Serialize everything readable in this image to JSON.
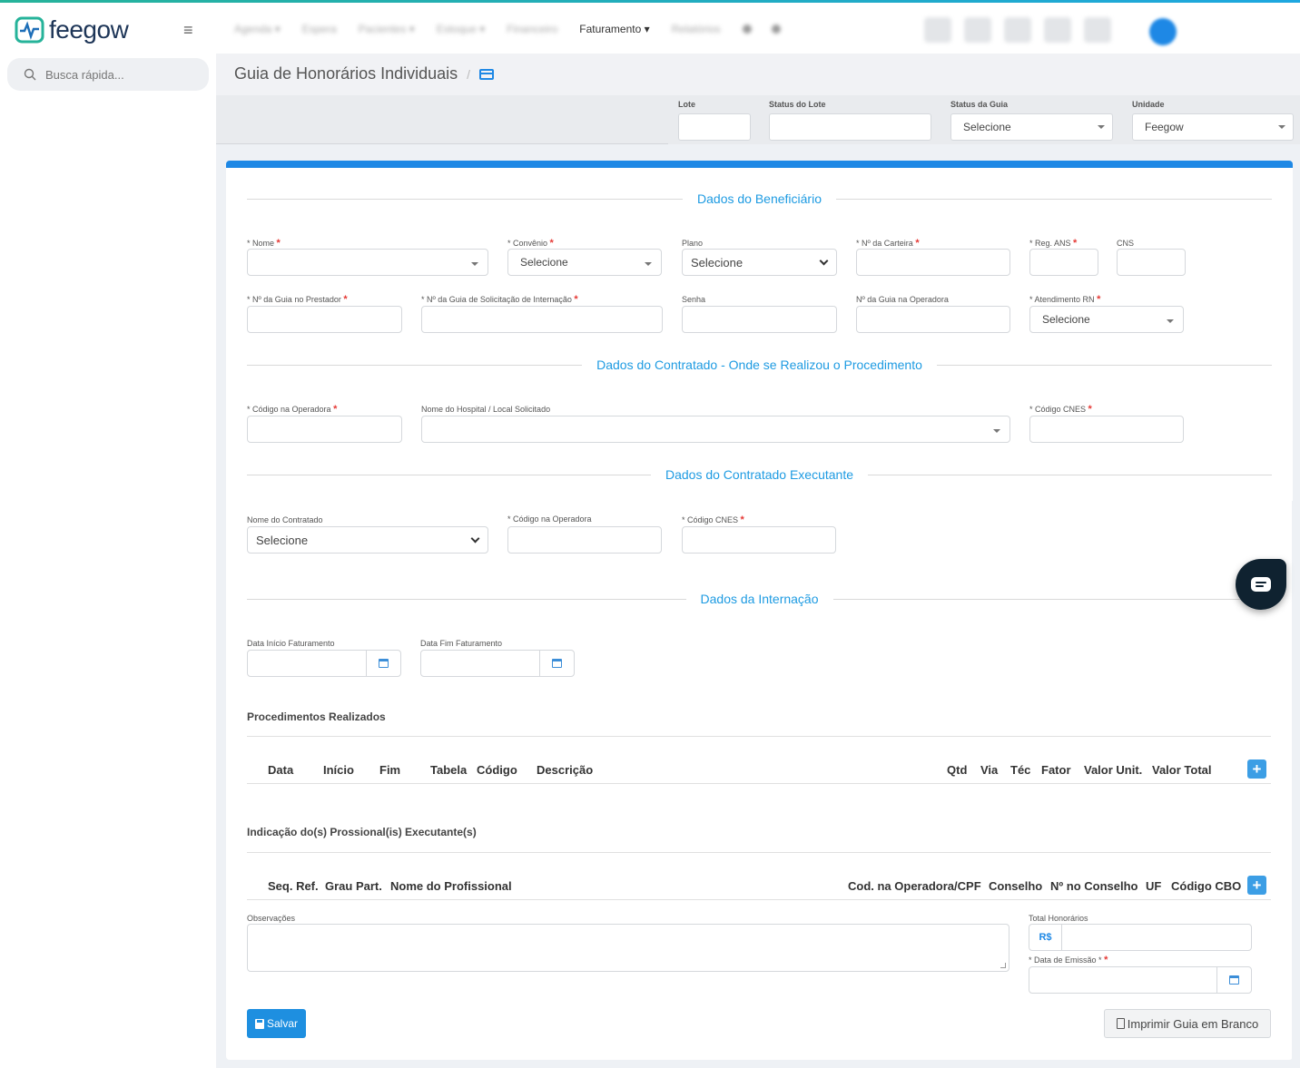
{
  "brand": {
    "name": "feegow"
  },
  "nav": {
    "items": [
      {
        "label": "Agenda ▾",
        "active": false
      },
      {
        "label": "Espera",
        "active": false
      },
      {
        "label": "Pacientes ▾",
        "active": false
      },
      {
        "label": "Estoque ▾",
        "active": false
      },
      {
        "label": "Financeiro",
        "active": false
      },
      {
        "label": "Faturamento ▾",
        "active": true
      },
      {
        "label": "Relatórios",
        "active": false
      }
    ]
  },
  "search": {
    "placeholder": "Busca rápida..."
  },
  "page": {
    "title": "Guia de Honorários Individuais",
    "separator": "/"
  },
  "filters": {
    "lote_label": "Lote",
    "status_lote_label": "Status do Lote",
    "status_guia_label": "Status da Guia",
    "status_guia_value": "Selecione",
    "unidade_label": "Unidade",
    "unidade_value": "Feegow"
  },
  "sections": {
    "beneficiario": "Dados do Beneficiário",
    "contratado": "Dados do Contratado - Onde se Realizou o Procedimento",
    "executante": "Dados do Contratado Executante",
    "internacao": "Dados da Internação"
  },
  "beneficiario": {
    "nome": "* Nome",
    "convenio": "* Convênio",
    "convenio_value": "Selecione",
    "plano": "Plano",
    "plano_value": "Selecione",
    "carteira": "* Nº da Carteira",
    "reg_ans": "* Reg. ANS",
    "cns": "CNS",
    "guia_prestador": "* Nº da Guia no Prestador",
    "guia_solicitacao": "* Nº da Guia de Solicitação de Internação",
    "senha": "Senha",
    "guia_operadora": "Nº da Guia na Operadora",
    "atendimento_rn": "* Atendimento RN",
    "atendimento_rn_value": "Selecione"
  },
  "contratado": {
    "codigo_operadora": "* Código na Operadora",
    "nome_hospital": "Nome do Hospital / Local Solicitado",
    "codigo_cnes": "* Código CNES"
  },
  "executante": {
    "nome_contratado": "Nome do Contratado",
    "nome_contratado_value": "Selecione",
    "codigo_operadora": "* Código na Operadora",
    "codigo_cnes": "* Código CNES"
  },
  "internacao": {
    "data_inicio": "Data Início Faturamento",
    "data_fim": "Data Fim Faturamento"
  },
  "procedimentos": {
    "title": "Procedimentos Realizados",
    "columns": [
      "Data",
      "Início",
      "Fim",
      "Tabela",
      "Código",
      "Descrição",
      "Qtd",
      "Via",
      "Téc",
      "Fator",
      "Valor Unit.",
      "Valor Total"
    ]
  },
  "profissionais": {
    "title": "Indicação do(s) Prossional(is) Executante(s)",
    "columns": [
      "Seq. Ref.",
      "Grau Part.",
      "Nome do Profissional",
      "Cod. na Operadora/CPF",
      "Conselho",
      "Nº no Conselho",
      "UF",
      "Código CBO"
    ]
  },
  "footer": {
    "observacoes": "Observações",
    "total_honorarios": "Total Honorários",
    "currency": "R$",
    "data_emissao": "* Data de Emissão *",
    "save_label": "Salvar",
    "print_label": "Imprimir Guia em Branco"
  },
  "required_mark": "*",
  "colors": {
    "accent": "#1e88e5",
    "section_title": "#1e9be2",
    "required": "#e53935"
  }
}
